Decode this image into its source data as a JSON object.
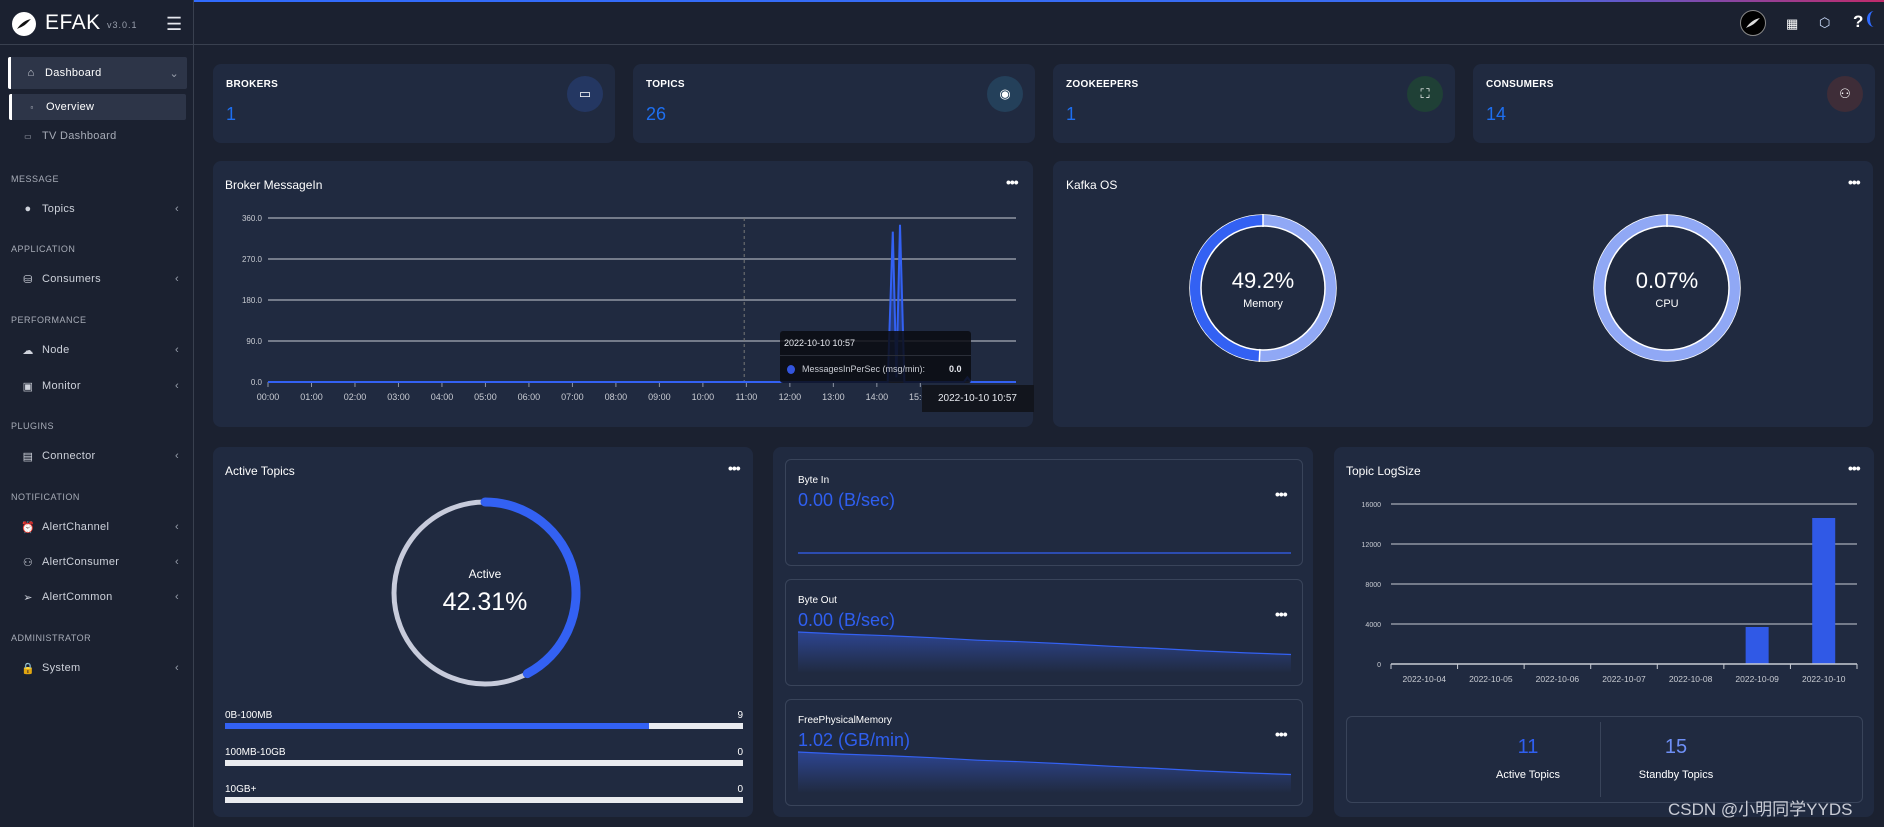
{
  "app": {
    "name": "EFAK",
    "version": "v3.0.1"
  },
  "colors": {
    "accent": "#3361f3",
    "value": "#1e6ff0",
    "card": "#202a40",
    "background": "#1b2130"
  },
  "header": {
    "icons": [
      "feather-logo-icon",
      "apps-grid-icon",
      "cube-icon",
      "help-icon",
      "loading-spinner-icon"
    ],
    "help": "?"
  },
  "sidebar": {
    "dashboard": {
      "label": "Dashboard",
      "icon": "home-icon",
      "children": [
        {
          "label": "Overview"
        },
        {
          "label": "TV Dashboard"
        }
      ]
    },
    "sections": [
      {
        "title": "MESSAGE",
        "items": [
          {
            "label": "Topics",
            "icon": "droplet-icon"
          }
        ]
      },
      {
        "title": "APPLICATION",
        "items": [
          {
            "label": "Consumers",
            "icon": "basket-icon"
          }
        ]
      },
      {
        "title": "PERFORMANCE",
        "items": [
          {
            "label": "Node",
            "icon": "cloud-icon"
          },
          {
            "label": "Monitor",
            "icon": "chart-icon"
          }
        ]
      },
      {
        "title": "PLUGINS",
        "items": [
          {
            "label": "Connector",
            "icon": "plug-icon"
          }
        ]
      },
      {
        "title": "NOTIFICATION",
        "items": [
          {
            "label": "AlertChannel",
            "icon": "alarm-icon"
          },
          {
            "label": "AlertConsumer",
            "icon": "user-signal-icon"
          },
          {
            "label": "AlertCommon",
            "icon": "send-icon"
          }
        ]
      },
      {
        "title": "ADMINISTRATOR",
        "items": [
          {
            "label": "System",
            "icon": "lock-icon"
          }
        ]
      }
    ]
  },
  "stats": [
    {
      "label": "BROKERS",
      "value": "1",
      "icon": "server-icon",
      "icon_bg": "#243762"
    },
    {
      "label": "TOPICS",
      "value": "26",
      "icon": "messenger-icon",
      "icon_bg": "#24405a"
    },
    {
      "label": "ZOOKEEPERS",
      "value": "1",
      "icon": "sitemap-icon",
      "icon_bg": "#1f4036"
    },
    {
      "label": "CONSUMERS",
      "value": "14",
      "icon": "users-icon",
      "icon_bg": "#3e2d38"
    }
  ],
  "broker": {
    "title": "Broker MessageIn",
    "tooltip": {
      "time": "2022-10-10 10:57",
      "series": "MessagesInPerSec (msg/min):",
      "value": "0.0"
    },
    "axis_pointer_label": "2022-10-10 10:57"
  },
  "kafka_os": {
    "title": "Kafka OS",
    "memory": {
      "value": "49.2%",
      "label": "Memory",
      "percent": 49.2
    },
    "cpu": {
      "value": "0.07%",
      "label": "CPU",
      "percent": 0.07
    }
  },
  "active_topics": {
    "title": "Active Topics",
    "label": "Active",
    "value": "42.31%",
    "percent": 42.31,
    "ranges": [
      {
        "label": "0B-100MB",
        "value": "9",
        "fraction": 0.818
      },
      {
        "label": "100MB-10GB",
        "value": "0",
        "fraction": 0
      },
      {
        "label": "10GB+",
        "value": "0",
        "fraction": 0
      }
    ]
  },
  "metrics": [
    {
      "title": "Byte In",
      "value": "0.00 (B/sec)",
      "spark": [
        0,
        0,
        0,
        0,
        0,
        0,
        0,
        0,
        0,
        0,
        0,
        0
      ]
    },
    {
      "title": "Byte Out",
      "value": "0.00 (B/sec)",
      "spark": [
        10,
        9.5,
        9.1,
        8.6,
        8,
        7.6,
        7.1,
        6.5,
        6,
        5.4,
        4.9,
        4.5
      ]
    },
    {
      "title": "FreePhysicalMemory",
      "value": "1.02 (GB/min)",
      "spark": [
        10,
        9.5,
        9.1,
        8.6,
        8,
        7.6,
        7.1,
        6.5,
        6,
        5.4,
        4.9,
        4.5
      ]
    }
  ],
  "topic_logsize": {
    "title": "Topic LogSize",
    "summary": [
      {
        "value": "11",
        "label": "Active Topics"
      },
      {
        "value": "15",
        "label": "Standby Topics"
      }
    ]
  },
  "chart_data": [
    {
      "type": "line",
      "title": "Broker MessageIn",
      "series": [
        {
          "name": "MessagesInPerSec (msg/min)",
          "points": [
            [
              "00:00",
              0
            ],
            [
              "10:57",
              0
            ],
            [
              "14:15",
              0
            ],
            [
              "14:22",
              330
            ],
            [
              "14:27",
              10
            ],
            [
              "14:32",
              345
            ],
            [
              "14:38",
              0
            ],
            [
              "16:00",
              0
            ],
            [
              "16:05",
              10
            ],
            [
              "16:10",
              0
            ],
            [
              "17:12",
              0
            ]
          ]
        }
      ],
      "xticks": [
        "00:00",
        "01:00",
        "02:00",
        "03:00",
        "04:00",
        "05:00",
        "06:00",
        "07:00",
        "08:00",
        "09:00",
        "10:00",
        "11:00",
        "12:00",
        "13:00",
        "14:00",
        "15:00"
      ],
      "xlim": [
        "00:00",
        "17:12"
      ],
      "yticks": [
        "0.0",
        "90.0",
        "180.0",
        "270.0",
        "360.0"
      ],
      "ylim": [
        0,
        360
      ],
      "grid": true
    },
    {
      "type": "bar",
      "title": "Topic LogSize",
      "categories": [
        "2022-10-04",
        "2022-10-05",
        "2022-10-06",
        "2022-10-07",
        "2022-10-08",
        "2022-10-09",
        "2022-10-10"
      ],
      "values": [
        0,
        0,
        0,
        0,
        0,
        3700,
        14600
      ],
      "yticks": [
        "0",
        "4000",
        "8000",
        "12000",
        "16000"
      ],
      "ylim": [
        0,
        16000
      ],
      "grid": true
    }
  ],
  "watermark": "CSDN @小明同学YYDS"
}
